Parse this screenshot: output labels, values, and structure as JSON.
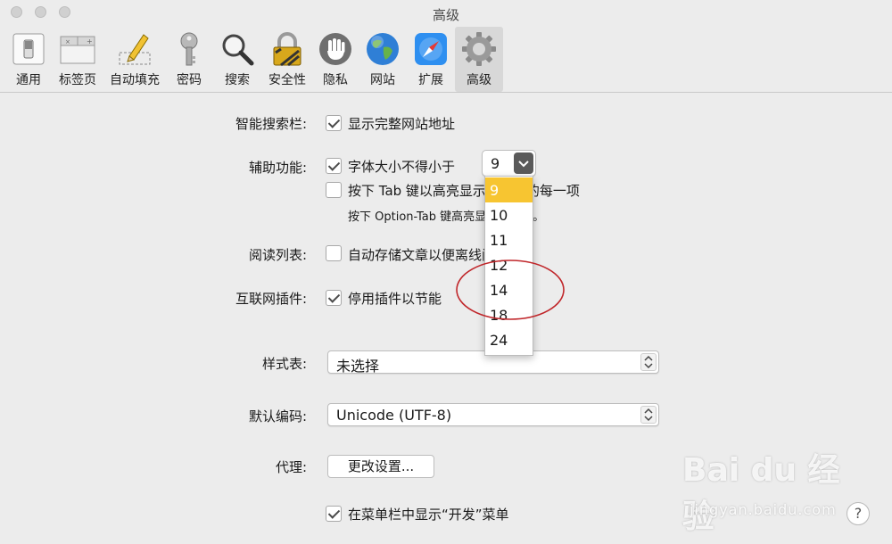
{
  "window": {
    "title": "高级"
  },
  "toolbar": [
    {
      "label": "通用",
      "icon": "general-switch-icon"
    },
    {
      "label": "标签页",
      "icon": "tabs-icon"
    },
    {
      "label": "自动填充",
      "icon": "autofill-pencil-icon"
    },
    {
      "label": "密码",
      "icon": "key-icon"
    },
    {
      "label": "搜索",
      "icon": "magnifier-icon"
    },
    {
      "label": "安全性",
      "icon": "padlock-icon"
    },
    {
      "label": "隐私",
      "icon": "hand-icon"
    },
    {
      "label": "网站",
      "icon": "globe-icon"
    },
    {
      "label": "扩展",
      "icon": "compass-icon"
    },
    {
      "label": "高级",
      "icon": "gear-icon"
    }
  ],
  "settings": {
    "smart_search_label": "智能搜索栏:",
    "smart_search_option": "显示完整网站地址",
    "accessibility_label": "辅助功能:",
    "font_size_option": "字体大小不得小于",
    "font_size_value": "9",
    "tab_highlight_option": "按下 Tab 键以高亮显示网页上的每一项",
    "tab_highlight_note": "按下 Option-Tab 键高亮显示每一项。",
    "reading_list_label": "阅读列表:",
    "reading_list_option": "自动存储文章以便离线阅读",
    "plugins_label": "互联网插件:",
    "plugins_option": "停用插件以节能",
    "stylesheet_label": "样式表:",
    "stylesheet_value": "未选择",
    "encoding_label": "默认编码:",
    "encoding_value": "Unicode (UTF-8)",
    "proxy_label": "代理:",
    "proxy_button": "更改设置...",
    "develop_option": "在菜单栏中显示“开发”菜单"
  },
  "font_menu": [
    "9",
    "10",
    "11",
    "12",
    "14",
    "18",
    "24"
  ],
  "watermark": {
    "main": "Bai du 经验",
    "sub": "jingyan.baidu.com"
  },
  "help": "?",
  "colors": {
    "menu_selected": "#f7c531",
    "annotation_circle": "#c0262a"
  }
}
